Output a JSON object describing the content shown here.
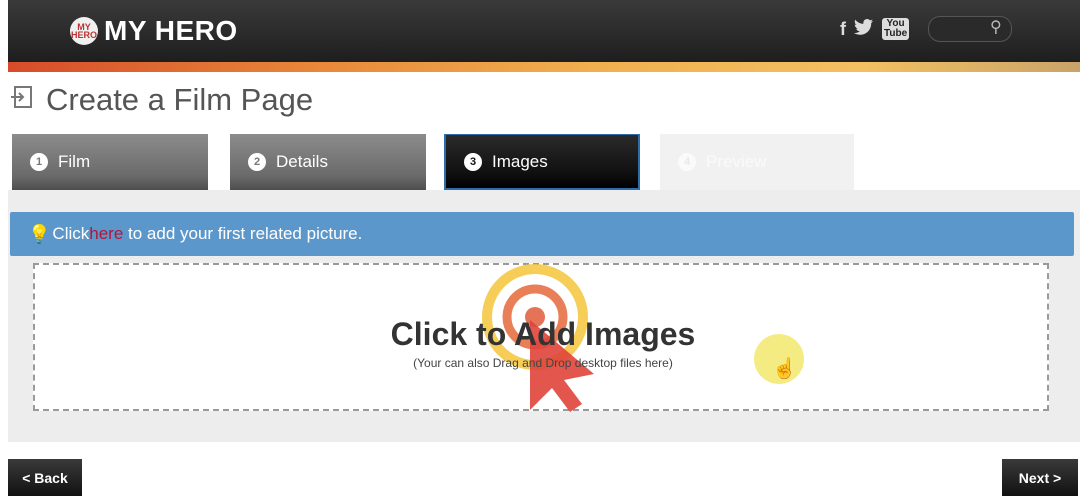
{
  "header": {
    "logo_badge": "MY HERO",
    "logo_text": "MY HERO",
    "social": {
      "facebook": "f",
      "twitter": "🐦",
      "youtube": "You Tube"
    },
    "search_placeholder": ""
  },
  "page": {
    "title": "Create a Film Page"
  },
  "tabs": [
    {
      "num": "1",
      "label": "Film"
    },
    {
      "num": "2",
      "label": "Details"
    },
    {
      "num": "3",
      "label": "Images"
    },
    {
      "num": "4",
      "label": "Preview"
    }
  ],
  "banner": {
    "prefix": "Click ",
    "link": "here",
    "suffix": " to add your first related picture."
  },
  "dropzone": {
    "title": "Click to Add Images",
    "subtitle": "(Your can also Drag and Drop desktop files here)"
  },
  "nav": {
    "back": "< Back",
    "next": "Next >"
  },
  "colors": {
    "banner": "#5c97cc",
    "link": "#b3163a",
    "active_tab_border": "#2e6ea8"
  }
}
